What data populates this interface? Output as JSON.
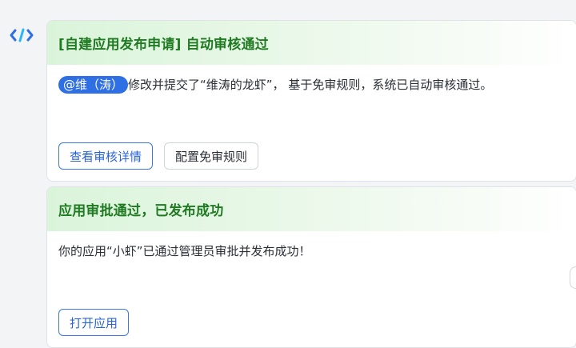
{
  "logo": {
    "icon": "code-brackets-icon",
    "colors": [
      "#2f6fe4",
      "#29b6f6"
    ]
  },
  "card1": {
    "title": "[自建应用发布申请] 自动审核通过",
    "mention": "@维（涛）",
    "message": "修改并提交了“维涛的龙虾”， 基于免审规则，系统已自动审核通过。",
    "buttons": {
      "primary": "查看审核详情",
      "secondary": "配置免审规则"
    }
  },
  "card2": {
    "title": "应用审批通过，已发布成功",
    "message": "你的应用“小虾”已通过管理员审批并发布成功！",
    "buttons": {
      "primary": "打开应用"
    }
  },
  "colors": {
    "title_green": "#1f7a22",
    "primary_blue": "#2f6fe4",
    "header_gradient": "#daf4da"
  }
}
